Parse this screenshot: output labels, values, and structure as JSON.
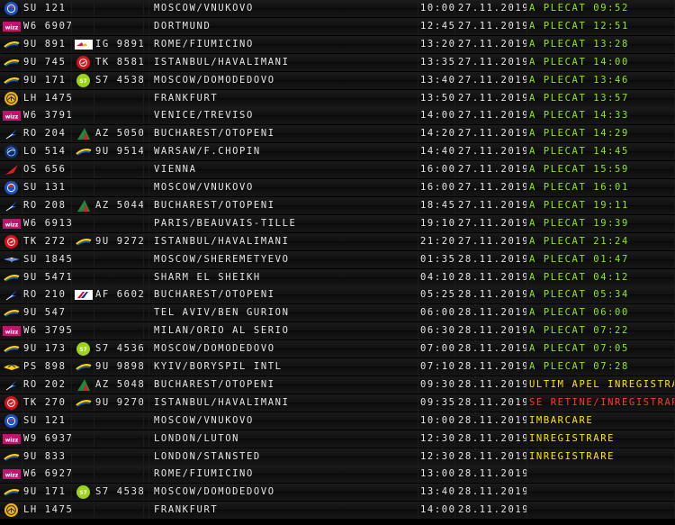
{
  "colors": {
    "text": "#e6e6e6",
    "status_green": "#8fe61e",
    "status_yellow": "#ffe600",
    "status_red": "#ff3b2b"
  },
  "flights": [
    {
      "logo": "aeroflot-globe-icon",
      "flight": "SU 121",
      "codeshare_logo": "",
      "codeshare": "",
      "destination": "MOSCOW/VNUKOVO",
      "time": "10:00",
      "date": "27.11.2019",
      "status": "A PLECAT 09:52",
      "status_color": "green"
    },
    {
      "logo": "wizz-air-icon",
      "flight": "W6 6907",
      "codeshare_logo": "",
      "codeshare": "",
      "destination": "DORTMUND",
      "time": "12:45",
      "date": "27.11.2019",
      "status": "A PLECAT 12:51",
      "status_color": "green"
    },
    {
      "logo": "tarom-swoosh-icon",
      "flight": "9U 891",
      "codeshare_logo": "iberia-logo-icon",
      "codeshare": "IG 9891",
      "destination": "ROME/FIUMICINO",
      "time": "13:20",
      "date": "27.11.2019",
      "status": "A PLECAT 13:28",
      "status_color": "green"
    },
    {
      "logo": "tarom-swoosh-icon",
      "flight": "9U 745",
      "codeshare_logo": "turkish-airlines-icon",
      "codeshare": "TK 8581",
      "destination": "ISTANBUL/HAVALIMANI",
      "time": "13:35",
      "date": "27.11.2019",
      "status": "A PLECAT 14:00",
      "status_color": "green"
    },
    {
      "logo": "tarom-swoosh-icon",
      "flight": "9U 171",
      "codeshare_logo": "s7-airlines-icon",
      "codeshare": "S7 4538",
      "destination": "MOSCOW/DOMODEDOVO",
      "time": "13:40",
      "date": "27.11.2019",
      "status": "A PLECAT 13:46",
      "status_color": "green"
    },
    {
      "logo": "lufthansa-crane-icon",
      "flight": "LH 1475",
      "codeshare_logo": "",
      "codeshare": "",
      "destination": "FRANKFURT",
      "time": "13:50",
      "date": "27.11.2019",
      "status": "A PLECAT 13:57",
      "status_color": "green"
    },
    {
      "logo": "wizz-air-icon",
      "flight": "W6 3791",
      "codeshare_logo": "",
      "codeshare": "",
      "destination": "VENICE/TREVISO",
      "time": "14:00",
      "date": "27.11.2019",
      "status": "A PLECAT 14:33",
      "status_color": "green"
    },
    {
      "logo": "tarom-bird-icon",
      "flight": "RO 204",
      "codeshare_logo": "alitalia-icon",
      "codeshare": "AZ 5050",
      "destination": "BUCHAREST/OTOPENI",
      "time": "14:20",
      "date": "27.11.2019",
      "status": "A PLECAT 14:29",
      "status_color": "green"
    },
    {
      "logo": "lot-crane-icon",
      "flight": "LO 514",
      "codeshare_logo": "tarom-swoosh-icon",
      "codeshare": "9U 9514",
      "destination": "WARSAW/F.CHOPIN",
      "time": "14:40",
      "date": "27.11.2019",
      "status": "A PLECAT 14:45",
      "status_color": "green"
    },
    {
      "logo": "austrian-arrow-icon",
      "flight": "OS 656",
      "codeshare_logo": "",
      "codeshare": "",
      "destination": "VIENNA",
      "time": "16:00",
      "date": "27.11.2019",
      "status": "A PLECAT 15:59",
      "status_color": "green"
    },
    {
      "logo": "aeroflot-globe-icon",
      "flight": "SU 131",
      "codeshare_logo": "",
      "codeshare": "",
      "destination": "MOSCOW/VNUKOVO",
      "time": "16:00",
      "date": "27.11.2019",
      "status": "A PLECAT 16:01",
      "status_color": "green"
    },
    {
      "logo": "tarom-bird-icon",
      "flight": "RO 208",
      "codeshare_logo": "alitalia-icon",
      "codeshare": "AZ 5044",
      "destination": "BUCHAREST/OTOPENI",
      "time": "18:45",
      "date": "27.11.2019",
      "status": "A PLECAT 19:11",
      "status_color": "green"
    },
    {
      "logo": "wizz-air-icon",
      "flight": "W6 6913",
      "codeshare_logo": "",
      "codeshare": "",
      "destination": "PARIS/BEAUVAIS-TILLE",
      "time": "19:10",
      "date": "27.11.2019",
      "status": "A PLECAT 19:39",
      "status_color": "green"
    },
    {
      "logo": "turkish-airlines-icon",
      "flight": "TK 272",
      "codeshare_logo": "tarom-swoosh-icon",
      "codeshare": "9U 9272",
      "destination": "ISTANBUL/HAVALIMANI",
      "time": "21:20",
      "date": "27.11.2019",
      "status": "A PLECAT 21:24",
      "status_color": "green"
    },
    {
      "logo": "aeroflot-wings-icon",
      "flight": "SU 1845",
      "codeshare_logo": "",
      "codeshare": "",
      "destination": "MOSCOW/SHEREMETYEVO",
      "time": "01:35",
      "date": "28.11.2019",
      "status": "A PLECAT 01:47",
      "status_color": "green"
    },
    {
      "logo": "tarom-swoosh-icon",
      "flight": "9U 5471",
      "codeshare_logo": "",
      "codeshare": "",
      "destination": "SHARM EL SHEIKH",
      "time": "04:10",
      "date": "28.11.2019",
      "status": "A PLECAT 04:12",
      "status_color": "green"
    },
    {
      "logo": "tarom-bird-icon",
      "flight": "RO 210",
      "codeshare_logo": "air-france-icon",
      "codeshare": "AF 6602",
      "destination": "BUCHAREST/OTOPENI",
      "time": "05:25",
      "date": "28.11.2019",
      "status": "A PLECAT 05:34",
      "status_color": "green"
    },
    {
      "logo": "tarom-swoosh-icon",
      "flight": "9U 547",
      "codeshare_logo": "",
      "codeshare": "",
      "destination": "TEL AVIV/BEN GURION",
      "time": "06:00",
      "date": "28.11.2019",
      "status": "A PLECAT 06:00",
      "status_color": "green"
    },
    {
      "logo": "wizz-air-icon",
      "flight": "W6 3795",
      "codeshare_logo": "",
      "codeshare": "",
      "destination": "MILAN/ORIO AL SERIO",
      "time": "06:30",
      "date": "28.11.2019",
      "status": "A PLECAT 07:22",
      "status_color": "green"
    },
    {
      "logo": "tarom-swoosh-icon",
      "flight": "9U 173",
      "codeshare_logo": "s7-airlines-icon",
      "codeshare": "S7 4536",
      "destination": "MOSCOW/DOMODEDOVO",
      "time": "07:00",
      "date": "28.11.2019",
      "status": "A PLECAT 07:05",
      "status_color": "green"
    },
    {
      "logo": "ukraine-intl-icon",
      "flight": "PS 898",
      "codeshare_logo": "tarom-swoosh-icon",
      "codeshare": "9U 9898",
      "destination": "KYIV/BORYSPIL INTL",
      "time": "07:10",
      "date": "28.11.2019",
      "status": "A PLECAT 07:28",
      "status_color": "green"
    },
    {
      "logo": "tarom-bird-icon",
      "flight": "RO 202",
      "codeshare_logo": "alitalia-icon",
      "codeshare": "AZ 5048",
      "destination": "BUCHAREST/OTOPENI",
      "time": "09:30",
      "date": "28.11.2019",
      "status": "ULTIM APEL INREGISTRA",
      "status_color": "yellow"
    },
    {
      "logo": "turkish-airlines-icon",
      "flight": "TK 270",
      "codeshare_logo": "tarom-swoosh-icon",
      "codeshare": "9U 9270",
      "destination": "ISTANBUL/HAVALIMANI",
      "time": "09:35",
      "date": "28.11.2019",
      "status": "SE RETINE/INREGISTRAR",
      "status_color": "red"
    },
    {
      "logo": "aeroflot-globe-icon",
      "flight": "SU 121",
      "codeshare_logo": "",
      "codeshare": "",
      "destination": "MOSCOW/VNUKOVO",
      "time": "10:00",
      "date": "28.11.2019",
      "status": "IMBARCARE",
      "status_color": "yellow"
    },
    {
      "logo": "wizz-air-icon",
      "flight": "W9 6937",
      "codeshare_logo": "",
      "codeshare": "",
      "destination": "LONDON/LUTON",
      "time": "12:30",
      "date": "28.11.2019",
      "status": "INREGISTRARE",
      "status_color": "yellow"
    },
    {
      "logo": "tarom-swoosh-icon",
      "flight": "9U 833",
      "codeshare_logo": "",
      "codeshare": "",
      "destination": "LONDON/STANSTED",
      "time": "12:30",
      "date": "28.11.2019",
      "status": "INREGISTRARE",
      "status_color": "yellow"
    },
    {
      "logo": "wizz-air-icon",
      "flight": "W6 6927",
      "codeshare_logo": "",
      "codeshare": "",
      "destination": "ROME/FIUMICINO",
      "time": "13:00",
      "date": "28.11.2019",
      "status": "",
      "status_color": "yellow"
    },
    {
      "logo": "tarom-swoosh-icon",
      "flight": "9U 171",
      "codeshare_logo": "s7-airlines-icon",
      "codeshare": "S7 4538",
      "destination": "MOSCOW/DOMODEDOVO",
      "time": "13:40",
      "date": "28.11.2019",
      "status": "",
      "status_color": "yellow"
    },
    {
      "logo": "lufthansa-crane-icon",
      "flight": "LH 1475",
      "codeshare_logo": "",
      "codeshare": "",
      "destination": "FRANKFURT",
      "time": "14:00",
      "date": "28.11.2019",
      "status": "",
      "status_color": "yellow"
    }
  ]
}
